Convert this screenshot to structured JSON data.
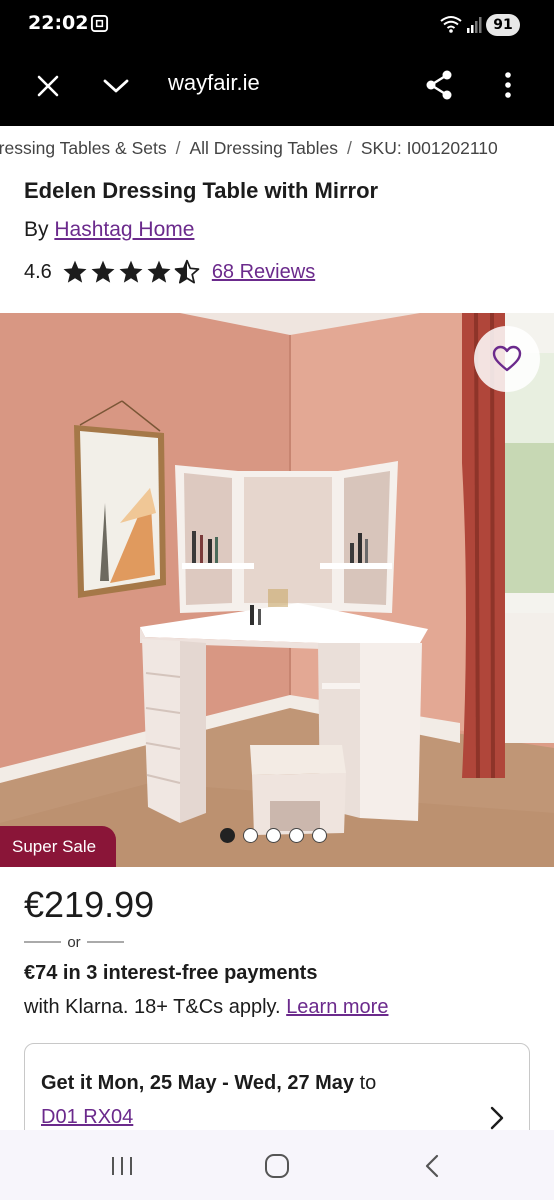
{
  "status_bar": {
    "time": "22:02",
    "battery": "91",
    "icons": [
      "screenshot-icon",
      "wifi-icon",
      "signal-icon",
      "battery-icon"
    ]
  },
  "browser": {
    "url": "wayfair.ie",
    "icons": [
      "close-icon",
      "chevron-down-icon",
      "share-icon",
      "more-vert-icon"
    ]
  },
  "breadcrumb": {
    "items": [
      "Dressing Tables & Sets",
      "All Dressing Tables",
      "SKU: I001202110"
    ],
    "separator": "/"
  },
  "product": {
    "title": "Edelen Dressing Table with Mirror",
    "by_prefix": "By",
    "brand": "Hashtag Home",
    "rating": "4.6",
    "rating_value": 4.6,
    "reviews": "68 Reviews",
    "badge": "Super Sale",
    "image_count": 5,
    "active_image": 0
  },
  "pricing": {
    "price": "€219.99",
    "or": "or",
    "klarna_bold": "€74 in 3 interest-free payments",
    "klarna_text": "with Klarna. 18+ T&Cs apply.",
    "learn_more": "Learn more"
  },
  "delivery": {
    "label": "Get it Mon, 25 May - Wed, 27 May",
    "to": "to",
    "postcode": "D01 RX04"
  },
  "nav": {
    "icons": [
      "recent-apps-icon",
      "home-icon",
      "back-icon"
    ]
  },
  "colors": {
    "link": "#6b2a8c",
    "badge": "#8a1538",
    "text": "#1c1c1c"
  }
}
